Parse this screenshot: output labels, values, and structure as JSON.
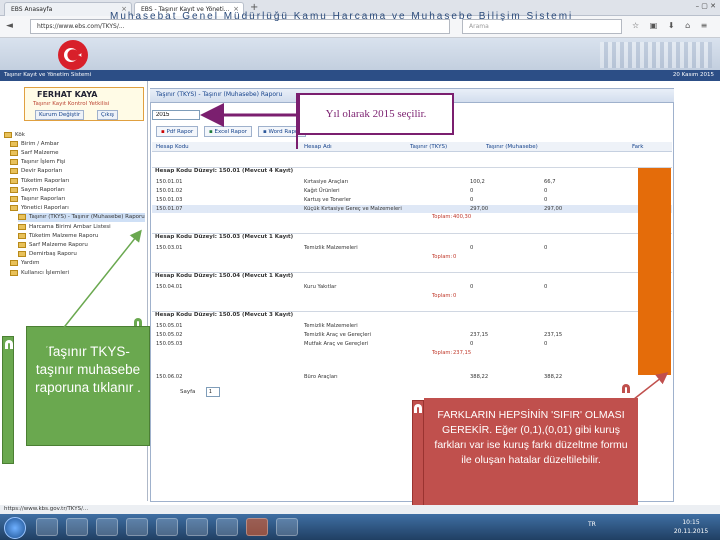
{
  "browser": {
    "tabs": [
      {
        "label": "EBS Anasayfa"
      },
      {
        "label": "EBS - Taşınır Kayıt ve Yöneti..."
      }
    ],
    "url": "https://www.ebs.com/TKYS/...",
    "search_placeholder": "Arama",
    "status_url": "https://www.kbs.gov.tr/TKYS/..."
  },
  "banner": {
    "title": "Muhasebat Genel Müdürlüğü Kamu Harcama ve Muhasebe Bilişim Sistemi",
    "system_name": "Taşınır Kayıt ve Yönetim Sistemi",
    "date": "20 Kasım 2015"
  },
  "user": {
    "name": "FERHAT KAYA",
    "role": "Taşınır Kayıt Kontrol Yetkilisi",
    "change_unit": "Kurum Değiştir",
    "logout": "Çıkış"
  },
  "tree": [
    {
      "label": "Kök"
    },
    {
      "label": "Birim / Ambar"
    },
    {
      "label": "Sarf Malzeme"
    },
    {
      "label": "Taşınır İşlem Fişi"
    },
    {
      "label": "Devir Raporları"
    },
    {
      "label": "Tüketim Raporları"
    },
    {
      "label": "Sayım Raporları"
    },
    {
      "label": "Taşınır Raporları"
    },
    {
      "label": "Yönetici Raporları"
    },
    {
      "label": "Taşınır (TKYS) - Taşınır (Muhasebe) Raporu",
      "selected": true
    },
    {
      "label": "Harcama Birimi Ambar Listesi"
    },
    {
      "label": "Tüketim Malzeme Raporu"
    },
    {
      "label": "Sarf Malzeme Raporu"
    },
    {
      "label": "Demirbaş Raporu"
    },
    {
      "label": "Yardım"
    },
    {
      "label": "Kullanıcı İşlemleri"
    }
  ],
  "main": {
    "tab": "Taşınır (TKYS) - Taşınır (Muhasebe) Raporu",
    "year": "2015",
    "buttons": {
      "pdf": "Pdf Rapor",
      "excel": "Excel Rapor",
      "word": "Word Rapor"
    },
    "columns": {
      "code": "Hesap Kodu",
      "name": "Hesap Adı",
      "tkys": "Taşınır (TKYS)",
      "muhasebe": "Taşınır (Muhasebe)",
      "fark": "Fark"
    },
    "groups": [
      {
        "label": "Hesap Kodu Düzeyi: 150.01 (Mevcut 4 Kayıt)"
      },
      {
        "label": "Hesap Kodu Düzeyi: 150.03 (Mevcut 1 Kayıt)"
      },
      {
        "label": "Hesap Kodu Düzeyi: 150.04 (Mevcut 1 Kayıt)"
      },
      {
        "label": "Hesap Kodu Düzeyi: 150.05 (Mevcut 3 Kayıt)"
      }
    ],
    "rows": [
      {
        "code": "150.01.01",
        "name": "Kırtasiye Araçları",
        "tkys": "100,2",
        "muh": "66,7"
      },
      {
        "code": "150.01.02",
        "name": "Kağıt Ürünleri",
        "tkys": "0",
        "muh": "0"
      },
      {
        "code": "150.01.03",
        "name": "Kartuş ve Tonerler",
        "tkys": "0",
        "muh": "0"
      },
      {
        "code": "150.01.07",
        "name": "Küçük Kırtasiye Gereç ve Malzemeleri",
        "tkys": "297,00",
        "muh": "297,00"
      },
      {
        "code": "150.03.01",
        "name": "Temizlik Malzemeleri",
        "tkys": "0",
        "muh": "0"
      },
      {
        "code": "150.04.01",
        "name": "Kuru Yakıtlar",
        "tkys": "0",
        "muh": "0"
      },
      {
        "code": "150.05.01",
        "name": "Temizlik Malzemeleri",
        "tkys": "",
        "muh": ""
      },
      {
        "code": "150.05.02",
        "name": "Temizlik Araç ve Gereçleri",
        "tkys": "237,15",
        "muh": "237,15"
      },
      {
        "code": "150.05.03",
        "name": "Mutfak Araç ve Gereçleri",
        "tkys": "0",
        "muh": "0"
      },
      {
        "code": "150.06.02",
        "name": "Büro Araçları",
        "tkys": "388,22",
        "muh": "388,22"
      }
    ],
    "totals_label": "Toplam:",
    "totals": [
      "400,30",
      "0",
      "0",
      "237,15"
    ],
    "pager_label": "Sayfa",
    "pager_value": "1"
  },
  "callouts": {
    "year": "Yıl olarak 2015 seçilir.",
    "tkys": "Taşınır TKYS-taşınır muhasebe raporuna tıklanır .",
    "fark": "FARKLARIN HEPSİNİN 'SIFIR' OLMASI GEREKİR. Eğer (0,1),(0,01) gibi kuruş farkları var ise kuruş farkı düzeltme formu ile oluşan hatalar düzeltilebilir."
  },
  "taskbar": {
    "lang": "TR",
    "time": "10:15",
    "date": "20.11.2015"
  },
  "colors": {
    "callout_green": "#6aa84f",
    "callout_red": "#c0504d",
    "highlight_orange": "#e46c0a",
    "arrow_purple": "#7b1f6f"
  }
}
